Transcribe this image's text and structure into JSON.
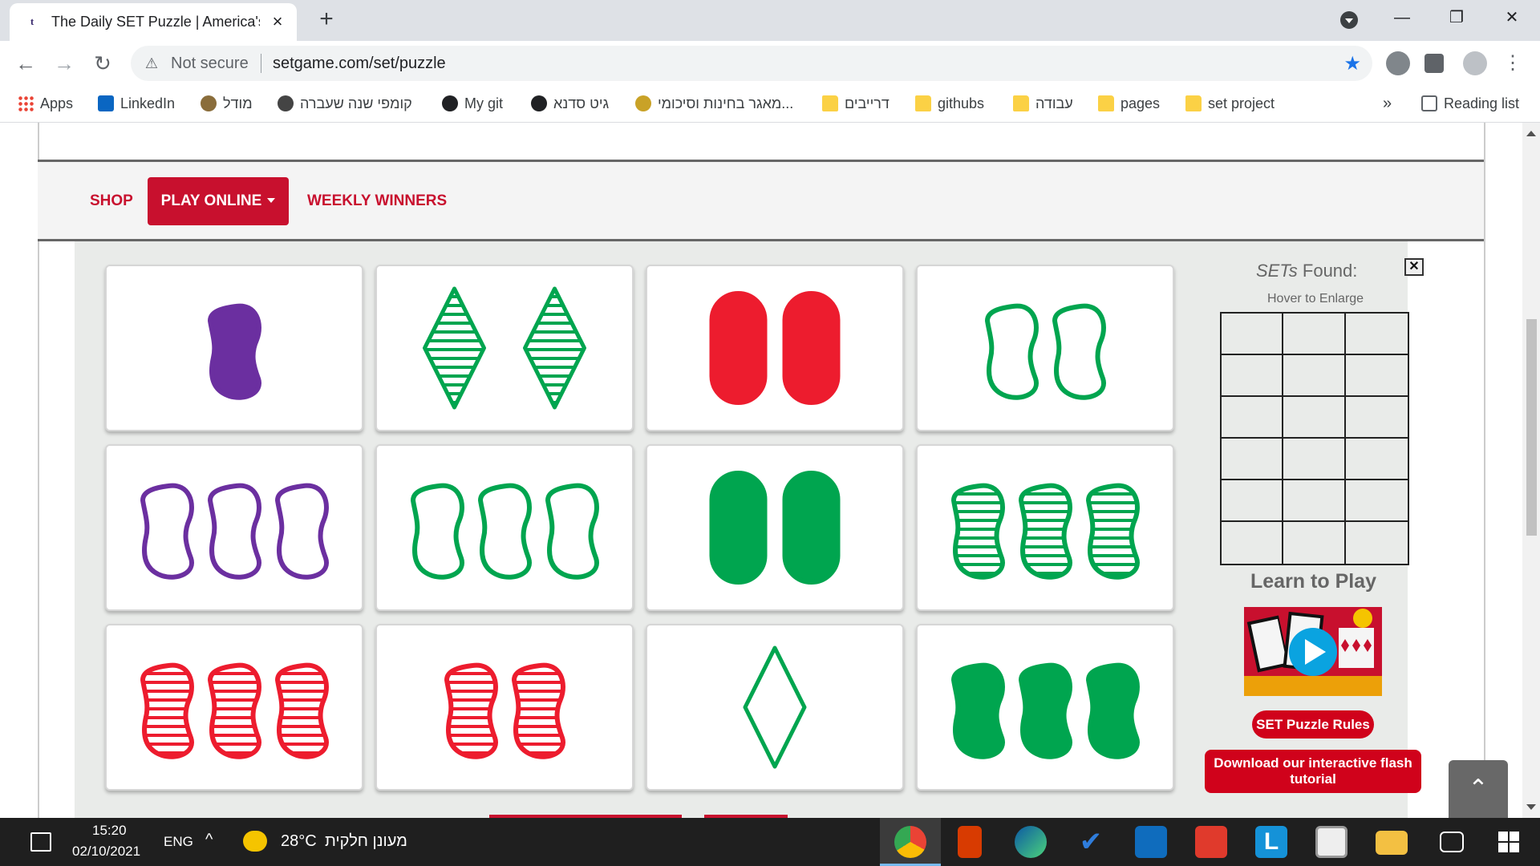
{
  "browser": {
    "tab_title": "The Daily SET Puzzle | America's F",
    "tab_favicon": "t",
    "new_tab": "+",
    "address_warning": "Not secure",
    "url": "setgame.com/set/puzzle",
    "window_controls": {
      "minimize": "—",
      "restore": "❐",
      "close": "✕"
    },
    "nav": {
      "back": "←",
      "forward": "→",
      "reload": "↻"
    },
    "bookmarks": [
      {
        "label": "Apps",
        "icon": "apps-grid-icon"
      },
      {
        "label": "LinkedIn",
        "icon": "linkedin-icon"
      },
      {
        "label": "מודל",
        "icon": "moodle-icon"
      },
      {
        "label": "קומפי שנה שעברה",
        "icon": "bookmark-icon"
      },
      {
        "label": "My git",
        "icon": "github-icon"
      },
      {
        "label": "גיט סדנא",
        "icon": "github-icon"
      },
      {
        "label": "מאגר בחינות וסיכומי...",
        "icon": "bookmark-icon"
      },
      {
        "label": "דרייבים",
        "icon": "folder-icon"
      },
      {
        "label": "githubs",
        "icon": "folder-icon"
      },
      {
        "label": "עבודה",
        "icon": "folder-icon"
      },
      {
        "label": "pages",
        "icon": "folder-icon"
      },
      {
        "label": "set project",
        "icon": "folder-icon"
      }
    ],
    "bookmarks_overflow": "»",
    "reading_list": "Reading list"
  },
  "site_nav": {
    "shop": "SHOP",
    "play_online": "PLAY ONLINE",
    "weekly_winners": "WEEKLY WINNERS"
  },
  "colors": {
    "red": "#ed1c2e",
    "green": "#00a54f",
    "purple": "#6b2fa0",
    "brand_red": "#c8102e"
  },
  "cards": [
    {
      "number": 1,
      "shape": "squiggle",
      "color": "purple",
      "shading": "solid"
    },
    {
      "number": 2,
      "shape": "diamond",
      "color": "green",
      "shading": "striped"
    },
    {
      "number": 2,
      "shape": "oval",
      "color": "red",
      "shading": "solid"
    },
    {
      "number": 2,
      "shape": "squiggle",
      "color": "green",
      "shading": "open"
    },
    {
      "number": 3,
      "shape": "squiggle",
      "color": "purple",
      "shading": "open"
    },
    {
      "number": 3,
      "shape": "squiggle",
      "color": "green",
      "shading": "open"
    },
    {
      "number": 2,
      "shape": "oval",
      "color": "green",
      "shading": "solid"
    },
    {
      "number": 3,
      "shape": "squiggle",
      "color": "green",
      "shading": "striped"
    },
    {
      "number": 3,
      "shape": "squiggle",
      "color": "red",
      "shading": "striped"
    },
    {
      "number": 2,
      "shape": "squiggle",
      "color": "red",
      "shading": "striped"
    },
    {
      "number": 1,
      "shape": "diamond",
      "color": "green",
      "shading": "open"
    },
    {
      "number": 3,
      "shape": "squiggle",
      "color": "green",
      "shading": "solid"
    }
  ],
  "panel": {
    "sets_found_italic": "SETs",
    "sets_found_rest": " Found:",
    "close": "✕",
    "hover_hint": "Hover to Enlarge",
    "found_slots": 18,
    "learn_title": "Learn to Play",
    "rules_button": "SET Puzzle Rules",
    "download_button": "Download our interactive flash tutorial",
    "back_to_top": "⌃"
  },
  "taskbar": {
    "time": "15:20",
    "date": "02/10/2021",
    "language": "ENG",
    "temperature": "28°C",
    "weather": "מעונן חלקית"
  }
}
